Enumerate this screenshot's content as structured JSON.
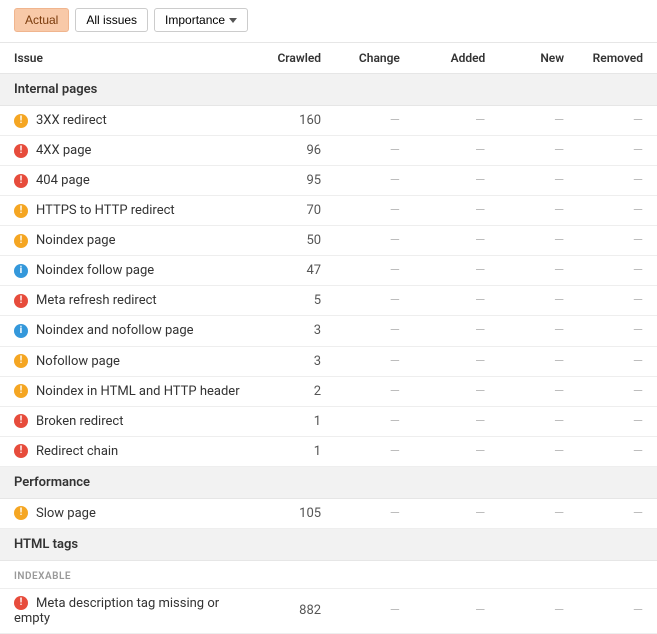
{
  "toolbar": {
    "actual_label": "Actual",
    "all_issues_label": "All issues",
    "importance_label": "Importance"
  },
  "columns": {
    "issue": "Issue",
    "crawled": "Crawled",
    "change": "Change",
    "added": "Added",
    "new": "New",
    "removed": "Removed"
  },
  "sections": [
    {
      "title": "Internal pages",
      "rows": [
        {
          "severity": "warning",
          "label": "3XX redirect",
          "crawled": "160"
        },
        {
          "severity": "error",
          "label": "4XX page",
          "crawled": "96"
        },
        {
          "severity": "error",
          "label": "404 page",
          "crawled": "95"
        },
        {
          "severity": "warning",
          "label": "HTTPS to HTTP redirect",
          "crawled": "70"
        },
        {
          "severity": "warning",
          "label": "Noindex page",
          "crawled": "50"
        },
        {
          "severity": "info",
          "label": "Noindex follow page",
          "crawled": "47"
        },
        {
          "severity": "error",
          "label": "Meta refresh redirect",
          "crawled": "5"
        },
        {
          "severity": "info",
          "label": "Noindex and nofollow page",
          "crawled": "3"
        },
        {
          "severity": "warning",
          "label": "Nofollow page",
          "crawled": "3"
        },
        {
          "severity": "warning",
          "label": "Noindex in HTML and HTTP header",
          "crawled": "2"
        },
        {
          "severity": "error",
          "label": "Broken redirect",
          "crawled": "1"
        },
        {
          "severity": "error",
          "label": "Redirect chain",
          "crawled": "1"
        }
      ]
    },
    {
      "title": "Performance",
      "rows": [
        {
          "severity": "warning",
          "label": "Slow page",
          "crawled": "105"
        }
      ]
    },
    {
      "title": "HTML tags",
      "subheader": "INDEXABLE",
      "rows": [
        {
          "severity": "error",
          "label": "Meta description tag missing or empty",
          "crawled": "882"
        }
      ]
    }
  ],
  "dash": "—",
  "severity_glyph": {
    "error": "!",
    "warning": "!",
    "info": "i"
  }
}
